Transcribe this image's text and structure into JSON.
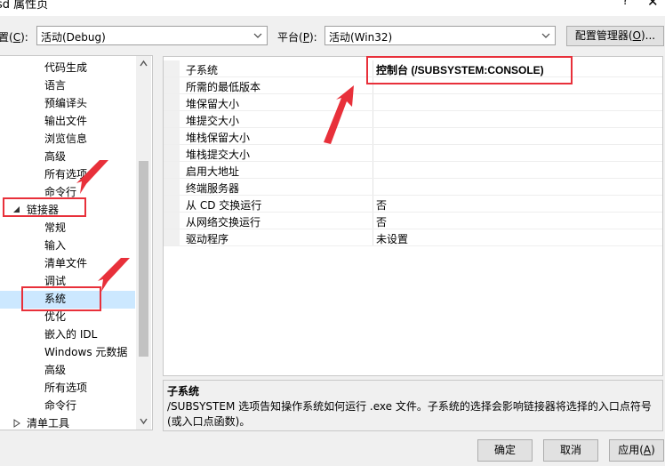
{
  "window": {
    "title": "sd 属性页",
    "help_glyph": "?",
    "close_glyph": "✕"
  },
  "config_bar": {
    "configuration_label_prefix": "置(",
    "configuration_label_key": "C",
    "configuration_label_suffix": "):",
    "configuration_value": "活动(Debug)",
    "platform_label_prefix": "平台(",
    "platform_label_key": "P",
    "platform_label_suffix": "):",
    "platform_value": "活动(Win32)",
    "manager_prefix": "配置管理器(",
    "manager_key": "O",
    "manager_suffix": ")..."
  },
  "tree": {
    "items": [
      {
        "label": "代码生成"
      },
      {
        "label": "语言"
      },
      {
        "label": "预编译头"
      },
      {
        "label": "输出文件"
      },
      {
        "label": "浏览信息"
      },
      {
        "label": "高级"
      },
      {
        "label": "所有选项"
      },
      {
        "label": "命令行"
      },
      {
        "label": "链接器"
      },
      {
        "label": "常规"
      },
      {
        "label": "输入"
      },
      {
        "label": "清单文件"
      },
      {
        "label": "调试"
      },
      {
        "label": "系统"
      },
      {
        "label": "优化"
      },
      {
        "label": "嵌入的 IDL"
      },
      {
        "label": "Windows 元数据"
      },
      {
        "label": "高级"
      },
      {
        "label": "所有选项"
      },
      {
        "label": "命令行"
      },
      {
        "label": "清单工具"
      }
    ],
    "selected": "系统"
  },
  "properties": [
    {
      "name": "子系统",
      "value": "控制台 (/SUBSYSTEM:CONSOLE)"
    },
    {
      "name": "所需的最低版本",
      "value": ""
    },
    {
      "name": "堆保留大小",
      "value": ""
    },
    {
      "name": "堆提交大小",
      "value": ""
    },
    {
      "name": "堆栈保留大小",
      "value": ""
    },
    {
      "name": "堆栈提交大小",
      "value": ""
    },
    {
      "name": "启用大地址",
      "value": ""
    },
    {
      "name": "终端服务器",
      "value": ""
    },
    {
      "name": "从 CD 交换运行",
      "value": "否"
    },
    {
      "name": "从网络交换运行",
      "value": "否"
    },
    {
      "name": "驱动程序",
      "value": "未设置"
    }
  ],
  "description": {
    "title": "子系统",
    "body": "/SUBSYSTEM 选项告知操作系统如何运行 .exe 文件。子系统的选择会影响链接器将选择的入口点符号(或入口点函数)。"
  },
  "buttons": {
    "ok": "确定",
    "cancel": "取消",
    "apply_prefix": "应用(",
    "apply_key": "A",
    "apply_suffix": ")"
  },
  "colors": {
    "annotation_red": "#e8303a",
    "selection_blue": "#cce8ff"
  }
}
